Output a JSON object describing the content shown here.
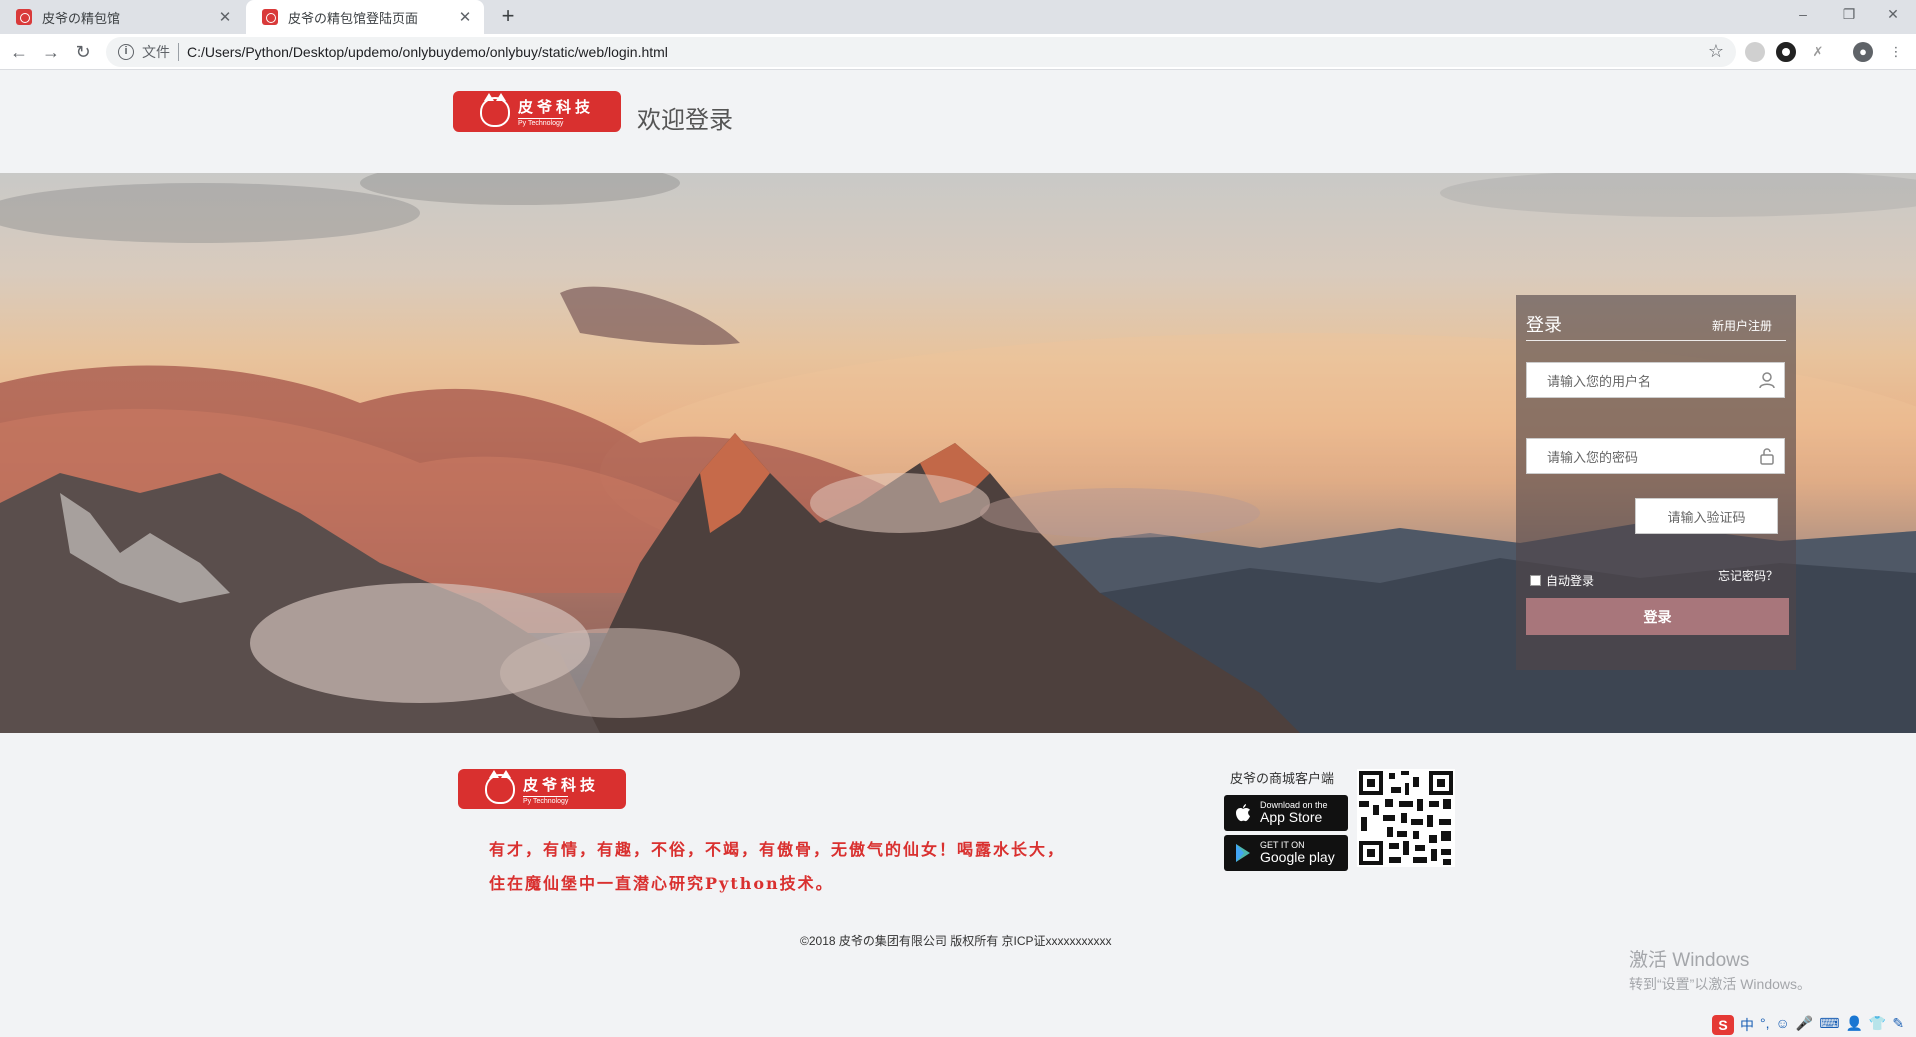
{
  "browser": {
    "tabs": [
      {
        "title": "皮爷の精包馆",
        "active": false
      },
      {
        "title": "皮爷の精包馆登陆页面",
        "active": true
      }
    ],
    "new_tab": "+",
    "address_scheme": "文件",
    "address_url": "C:/Users/Python/Desktop/updemo/onlybuydemo/onlybuy/static/web/login.html",
    "window_controls": {
      "minimize": "–",
      "restore": "❐",
      "close": "✕"
    }
  },
  "header": {
    "logo_text": "皮爷科技",
    "logo_subtext": "Py Technology",
    "welcome": "欢迎登录"
  },
  "login": {
    "title": "登录",
    "register_link": "新用户注册",
    "username_placeholder": "请输入您的用户名",
    "password_placeholder": "请输入您的密码",
    "captcha_placeholder": "请输入验证码",
    "auto_login": "自动登录",
    "forgot_password": "忘记密码？",
    "submit": "登录"
  },
  "footer": {
    "logo_text": "皮爷科技",
    "logo_subtext": "Py Technology",
    "slogan_line1": "有才，有情，有趣，不俗，不竭，有傲骨，无傲气的仙女！喝露水长大，",
    "slogan_line2": "住在魔仙堡中一直潜心研究Python技术。",
    "client_label": "皮爷の商城客户端",
    "app_store_small": "Download on the",
    "app_store_big": "App Store",
    "google_play_small": "GET IT ON",
    "google_play_big": "Google play",
    "copyright": "©2018 皮爷の集团有限公司 版权所有 京ICP证xxxxxxxxxxx"
  },
  "os": {
    "activate_title": "激活 Windows",
    "activate_sub": "转到“设置”以激活 Windows。",
    "ime_items": [
      "中",
      "°,",
      "☺",
      "🎤",
      "⌨",
      "👤",
      "👕",
      "✎"
    ]
  },
  "colors": {
    "brand_red": "#d9302f",
    "login_button": "#a8767b",
    "page_bg": "#f2f3f5"
  }
}
